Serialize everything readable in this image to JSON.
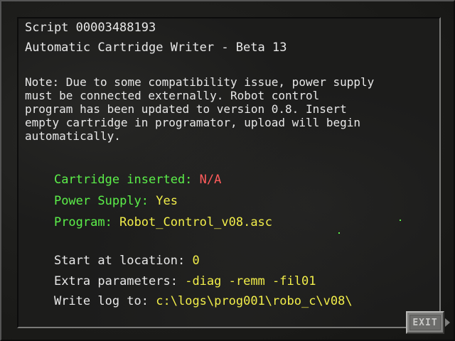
{
  "header": {
    "script_id": "Script 00003488193",
    "app_title": "Automatic Cartridge Writer - Beta 13"
  },
  "note": "Note: Due to some compatibility issue, power supply\nmust be connected externally. Robot control\nprogram has been updated to version 0.8. Insert\nempty cartridge in programator, upload will begin\nautomatically.",
  "status": {
    "cartridge_label": "Cartridge inserted:",
    "cartridge_value": "N/A",
    "power_label": "Power Supply:",
    "power_value": "Yes",
    "program_label": "Program:",
    "program_value": "Robot_Control_v08.asc"
  },
  "settings": {
    "start_label": "Start at location:",
    "start_value": "0",
    "extra_label": "Extra parameters:",
    "extra_value": "-diag -remm -fil01",
    "log_label": "Write log to:",
    "log_value": "c:\\logs\\prog001\\robo_c\\v08\\"
  },
  "exit_button": {
    "label": "EXIT"
  },
  "colors": {
    "text_white": "#e8e8e8",
    "label_green": "#5cf04a",
    "value_yellow": "#f2ee4a",
    "value_red": "#ff5c5c"
  }
}
